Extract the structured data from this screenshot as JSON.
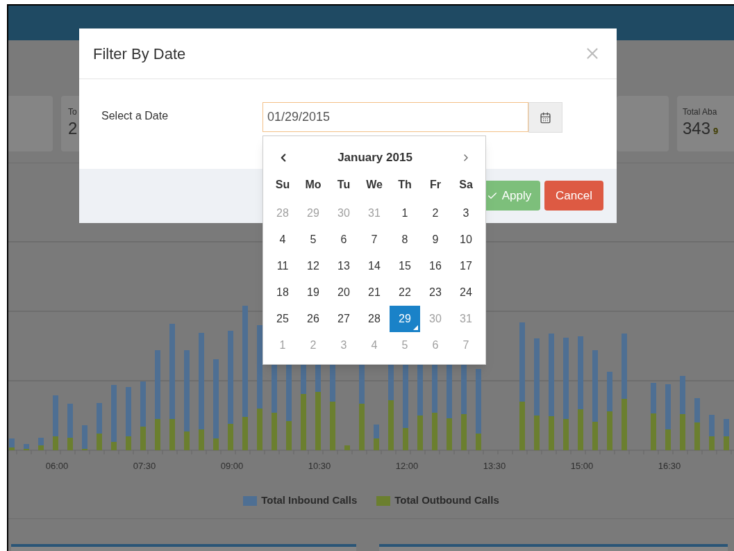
{
  "stat_cards": [
    {
      "label": "To",
      "value": "2"
    },
    {
      "label": "Total Aba",
      "value": "343",
      "note": "9"
    }
  ],
  "chart": {
    "x_labels": [
      "06:00",
      "07:30",
      "09:00",
      "10:30",
      "12:00",
      "13:30",
      "15:00",
      "16:30"
    ],
    "legend": [
      {
        "label": "Total Inbound Calls",
        "color": "#4e6f93"
      },
      {
        "label": "Total Outbound Calls",
        "color": "#6b7f2f"
      }
    ]
  },
  "dialog": {
    "title": "Filter By Date",
    "field_label": "Select a Date",
    "date_value": "01/29/2015",
    "buttons": [
      {
        "label": "Apply",
        "kind": "apply"
      },
      {
        "label": "Cancel",
        "kind": "cancel"
      }
    ]
  },
  "datepicker": {
    "month": "January 2015",
    "weekdays": [
      "Su",
      "Mo",
      "Tu",
      "We",
      "Th",
      "Fr",
      "Sa"
    ],
    "weeks": [
      [
        {
          "day": "28",
          "muted": true,
          "selected": false
        },
        {
          "day": "29",
          "muted": true,
          "selected": false
        },
        {
          "day": "30",
          "muted": true,
          "selected": false
        },
        {
          "day": "31",
          "muted": true,
          "selected": false
        },
        {
          "day": "1",
          "muted": false,
          "selected": false
        },
        {
          "day": "2",
          "muted": false,
          "selected": false
        },
        {
          "day": "3",
          "muted": false,
          "selected": false
        }
      ],
      [
        {
          "day": "4",
          "muted": false,
          "selected": false
        },
        {
          "day": "5",
          "muted": false,
          "selected": false
        },
        {
          "day": "6",
          "muted": false,
          "selected": false
        },
        {
          "day": "7",
          "muted": false,
          "selected": false
        },
        {
          "day": "8",
          "muted": false,
          "selected": false
        },
        {
          "day": "9",
          "muted": false,
          "selected": false
        },
        {
          "day": "10",
          "muted": false,
          "selected": false
        }
      ],
      [
        {
          "day": "11",
          "muted": false,
          "selected": false
        },
        {
          "day": "12",
          "muted": false,
          "selected": false
        },
        {
          "day": "13",
          "muted": false,
          "selected": false
        },
        {
          "day": "14",
          "muted": false,
          "selected": false
        },
        {
          "day": "15",
          "muted": false,
          "selected": false
        },
        {
          "day": "16",
          "muted": false,
          "selected": false
        },
        {
          "day": "17",
          "muted": false,
          "selected": false
        }
      ],
      [
        {
          "day": "18",
          "muted": false,
          "selected": false
        },
        {
          "day": "19",
          "muted": false,
          "selected": false
        },
        {
          "day": "20",
          "muted": false,
          "selected": false
        },
        {
          "day": "21",
          "muted": false,
          "selected": false
        },
        {
          "day": "22",
          "muted": false,
          "selected": false
        },
        {
          "day": "23",
          "muted": false,
          "selected": false
        },
        {
          "day": "24",
          "muted": false,
          "selected": false
        }
      ],
      [
        {
          "day": "25",
          "muted": false,
          "selected": false
        },
        {
          "day": "26",
          "muted": false,
          "selected": false
        },
        {
          "day": "27",
          "muted": false,
          "selected": false
        },
        {
          "day": "28",
          "muted": false,
          "selected": false
        },
        {
          "day": "29",
          "muted": false,
          "selected": true
        },
        {
          "day": "30",
          "muted": true,
          "selected": false
        },
        {
          "day": "31",
          "muted": true,
          "selected": false
        }
      ],
      [
        {
          "day": "1",
          "muted": true,
          "selected": false
        },
        {
          "day": "2",
          "muted": true,
          "selected": false
        },
        {
          "day": "3",
          "muted": true,
          "selected": false
        },
        {
          "day": "4",
          "muted": true,
          "selected": false
        },
        {
          "day": "5",
          "muted": true,
          "selected": false
        },
        {
          "day": "6",
          "muted": true,
          "selected": false
        },
        {
          "day": "7",
          "muted": true,
          "selected": false
        }
      ]
    ]
  }
}
